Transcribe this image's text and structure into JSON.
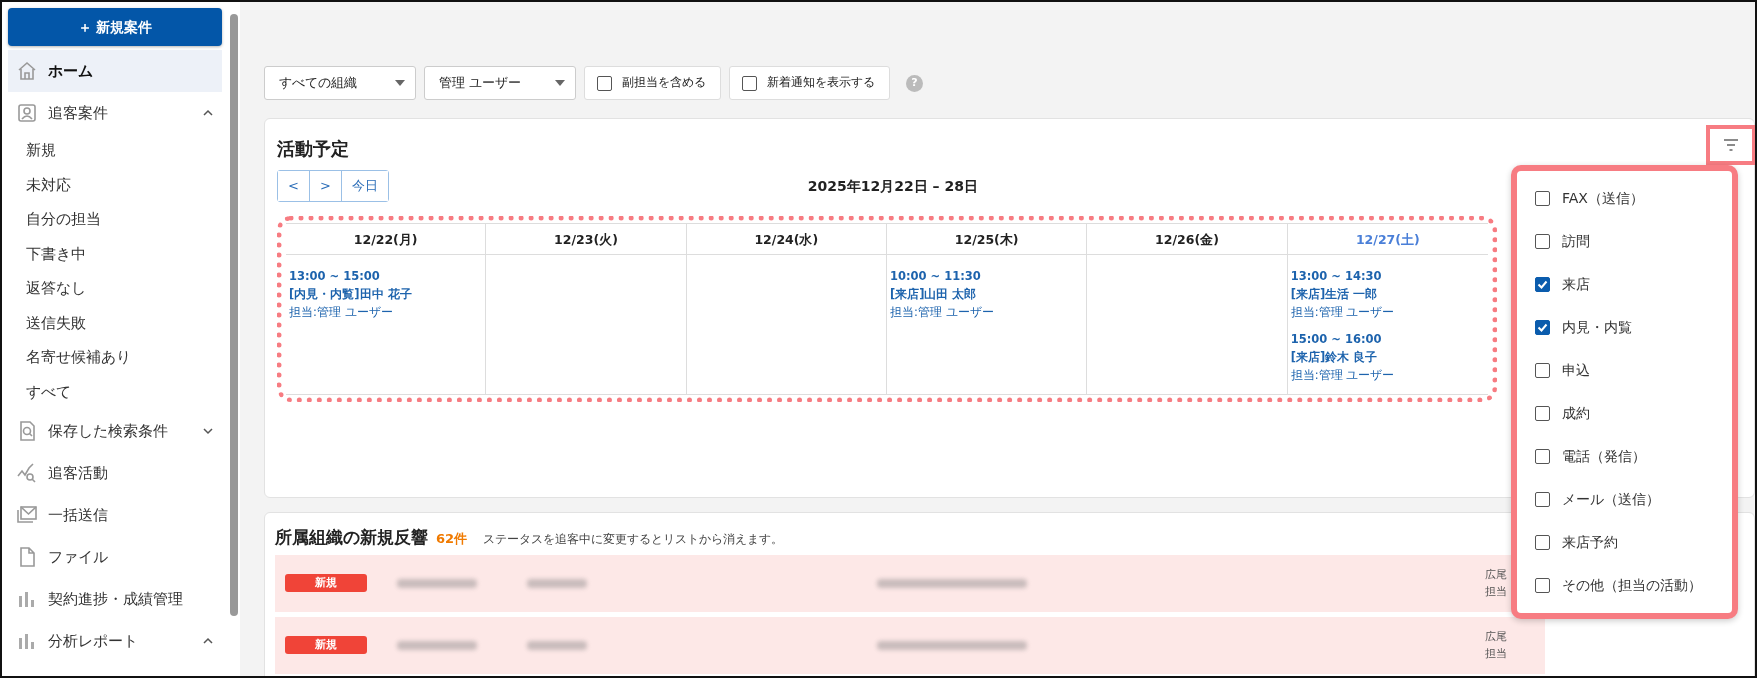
{
  "sidebar": {
    "new_button": {
      "icon": "＋",
      "label": "新規案件"
    },
    "items": [
      {
        "kind": "item",
        "label": "ホーム",
        "selected": true
      },
      {
        "kind": "group",
        "label": "追客案件",
        "expanded": true,
        "selected": false,
        "children": [
          {
            "label": "新規",
            "selected": false
          },
          {
            "label": "未対応",
            "selected": false
          },
          {
            "label": "自分の担当",
            "selected": false
          },
          {
            "label": "下書き中",
            "selected": false
          },
          {
            "label": "返答なし",
            "selected": false
          },
          {
            "label": "送信失敗",
            "selected": false
          },
          {
            "label": "名寄せ候補あり",
            "selected": false
          },
          {
            "label": "すべて",
            "selected": false
          }
        ]
      },
      {
        "kind": "group",
        "label": "保存した検索条件",
        "expanded": false,
        "selected": false
      },
      {
        "kind": "item",
        "label": "追客活動",
        "selected": false
      },
      {
        "kind": "item",
        "label": "一括送信",
        "selected": false
      },
      {
        "kind": "item",
        "label": "ファイル",
        "selected": false
      },
      {
        "kind": "item",
        "label": "契約進捗・成績管理",
        "selected": false
      },
      {
        "kind": "group",
        "label": "分析レポート",
        "expanded": true,
        "selected": false
      }
    ]
  },
  "filters": {
    "dropdowns": [
      "すべての組織",
      "管理 ユーザー"
    ],
    "checkboxes": [
      {
        "label": "副担当を含める",
        "checked": false
      },
      {
        "label": "新着通知を表示する",
        "checked": false
      }
    ],
    "help": "?"
  },
  "schedule": {
    "title": "活動予定",
    "nav": [
      "<",
      ">",
      "今日"
    ],
    "range": "2025年12月22日 – 28日",
    "days": [
      {
        "label": "12/22(月)",
        "weekend": false,
        "events": [
          {
            "time": "13:00 ~ 15:00",
            "title": "[内見・内覧]田中 花子",
            "owner": "担当:管理 ユーザー"
          }
        ]
      },
      {
        "label": "12/23(火)",
        "weekend": false
      },
      {
        "label": "12/24(水)",
        "weekend": false
      },
      {
        "label": "12/25(木)",
        "weekend": false,
        "events": [
          {
            "time": "10:00 ~ 11:30",
            "title": "[来店]山田 太郎",
            "owner": "担当:管理 ユーザー"
          }
        ]
      },
      {
        "label": "12/26(金)",
        "weekend": false
      },
      {
        "label": "12/27(土)",
        "weekend": true,
        "events": [
          {
            "time": "13:00 ~ 14:30",
            "title": "[来店]生活 一郎",
            "owner": "担当:管理 ユーザー"
          },
          {
            "time": "15:00 ~ 16:00",
            "title": "[来店]鈴木 良子",
            "owner": "担当:管理 ユーザー"
          }
        ]
      }
    ],
    "filter_menu": [
      {
        "label": "FAX（送信）",
        "checked": false
      },
      {
        "label": "訪問",
        "checked": false
      },
      {
        "label": "来店",
        "checked": true
      },
      {
        "label": "内見・内覧",
        "checked": true
      },
      {
        "label": "申込",
        "checked": false
      },
      {
        "label": "成約",
        "checked": false
      },
      {
        "label": "電話（発信）",
        "checked": false
      },
      {
        "label": "メール（送信）",
        "checked": false
      },
      {
        "label": "来店予約",
        "checked": false
      },
      {
        "label": "その他（担当の活動）",
        "checked": false
      }
    ]
  },
  "new_responses": {
    "title": "所属組織の新規反響",
    "count": "62件",
    "note": "ステータスを追客中に変更するとリストから消えます。",
    "rows": [
      {
        "badge": "新規",
        "office": "広尾",
        "owner": "担当"
      },
      {
        "badge": "新規",
        "office": "広尾",
        "owner": "担当"
      }
    ]
  }
}
